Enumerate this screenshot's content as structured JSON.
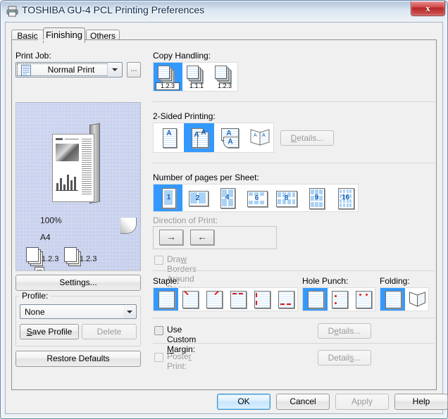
{
  "window": {
    "title": "TOSHIBA GU-4 PCL Printing Preferences",
    "icon": "printer-icon",
    "close_label": "x",
    "accent_selected": "#3399ff",
    "accent_red": "#e01b1b"
  },
  "tabs": [
    {
      "label": "Basic",
      "selected": false
    },
    {
      "label": "Finishing",
      "selected": true
    },
    {
      "label": "Others",
      "selected": false
    }
  ],
  "left": {
    "print_job_label": "Print Job:",
    "print_job_value": "Normal Print",
    "print_job_more": "...",
    "preview": {
      "zoom": "100%",
      "paper": "A4",
      "stack_labels": [
        "1.2.3",
        "1.2.3"
      ]
    },
    "settings_label": "Settings...",
    "profile_label": "Profile:",
    "profile_value": "None",
    "save_profile_label": "Save Profile",
    "delete_label": "Delete",
    "restore_defaults_label": "Restore Defaults"
  },
  "right": {
    "copy_handling": {
      "label": "Copy Handling:",
      "options": [
        {
          "label": "1.2.3",
          "selected": true
        },
        {
          "label": "1.1.1",
          "selected": false
        },
        {
          "label": "1.2.3",
          "selected": false
        }
      ]
    },
    "two_sided": {
      "label": "2-Sided Printing:",
      "options": [
        {
          "name": "none",
          "selected": false
        },
        {
          "name": "long-edge",
          "selected": true
        },
        {
          "name": "short-edge",
          "selected": false
        },
        {
          "name": "booklet",
          "selected": false
        }
      ],
      "details_label": "Details...",
      "details_enabled": false
    },
    "pages_per_sheet": {
      "label": "Number of pages per Sheet:",
      "options": [
        "1",
        "2",
        "4",
        "6",
        "8",
        "9",
        "16"
      ],
      "selected_index": 0
    },
    "direction_of_print": {
      "label": "Direction of Print:",
      "enabled": false,
      "options": [
        {
          "name": "left-to-right",
          "glyph": "→"
        },
        {
          "name": "right-to-left",
          "glyph": "←"
        }
      ]
    },
    "draw_borders": {
      "label": "Draw Borders Around Pages",
      "checked": false,
      "enabled": false
    },
    "staple": {
      "label": "Staple:",
      "options": [
        {
          "name": "off",
          "selected": true
        },
        {
          "name": "top-left",
          "selected": false
        },
        {
          "name": "top-right",
          "selected": false
        },
        {
          "name": "top-double",
          "selected": false
        },
        {
          "name": "left-double",
          "selected": false
        },
        {
          "name": "bottom-double",
          "selected": false
        }
      ]
    },
    "hole_punch": {
      "label": "Hole Punch:",
      "options": [
        {
          "name": "off",
          "selected": true
        },
        {
          "name": "left",
          "selected": false
        },
        {
          "name": "top",
          "selected": false
        }
      ]
    },
    "folding": {
      "label": "Folding:",
      "options": [
        {
          "name": "off",
          "selected": true
        },
        {
          "name": "booklet-fold",
          "selected": false
        }
      ]
    },
    "use_custom_margin": {
      "label": "Use Custom Margin:",
      "checked": false,
      "enabled": true,
      "details_label": "Details...",
      "details_enabled": false
    },
    "poster_print": {
      "label": "Poster Print:",
      "checked": false,
      "enabled": false,
      "details_label": "Details...",
      "details_enabled": false
    }
  },
  "footer": {
    "ok_label": "OK",
    "cancel_label": "Cancel",
    "apply_label": "Apply",
    "apply_enabled": false,
    "help_label": "Help"
  }
}
